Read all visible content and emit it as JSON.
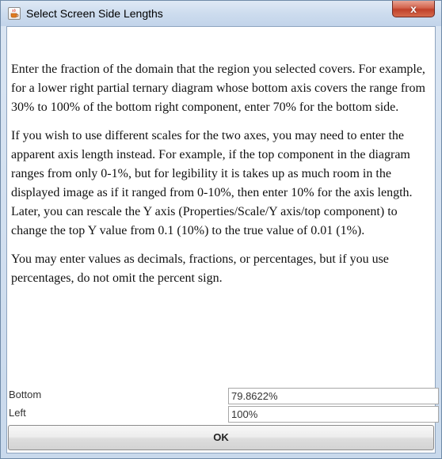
{
  "window": {
    "title": "Select Screen Side Lengths",
    "close_label": "x",
    "icon": "java-cup-icon"
  },
  "body": {
    "paragraphs": [
      "Enter the fraction of the domain that the region you selected covers. For example, for a lower right partial ternary diagram whose bottom axis covers the range from 30% to 100% of the bottom right component, enter 70% for the bottom side.",
      "If you wish to use different scales for the two axes, you may need to enter the apparent axis length instead. For example, if the top component in the diagram ranges from only 0-1%, but for legibility it is takes up as much room in the displayed image as if it ranged from 0-10%, then enter 10% for the axis length. Later, you can rescale the Y axis (Properties/Scale/Y axis/top component) to change the top Y value from 0.1 (10%) to the true value of 0.01 (1%).",
      "You may enter values as decimals, fractions, or percentages, but if you use percentages, do not omit the percent sign."
    ]
  },
  "fields": [
    {
      "label": "Bottom",
      "value": "79.8622%"
    },
    {
      "label": "Left",
      "value": "100%"
    }
  ],
  "ok_label": "OK"
}
